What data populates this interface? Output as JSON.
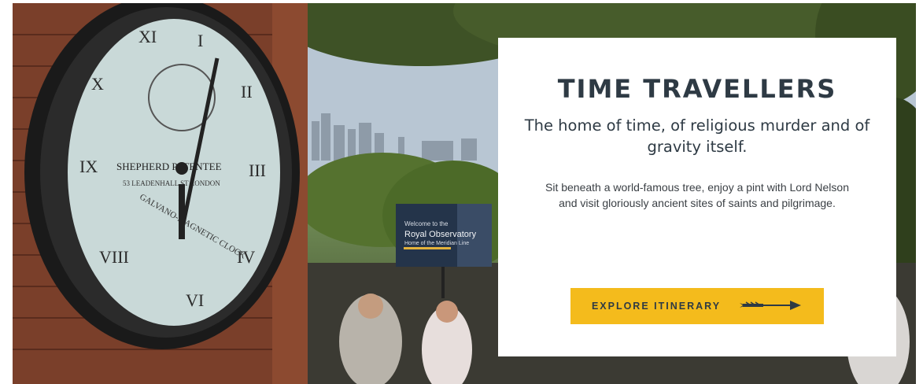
{
  "hero": {
    "photo_subject": "Shepherd Gate Clock at the Royal Observatory, Greenwich",
    "clock_face": {
      "maker_line": "SHEPHERD PATENTEE",
      "address_line": "53 LEADENHALL ST LONDON",
      "arc_line": "GALVANO-MAGNETIC CLOCK"
    },
    "sign": {
      "line1": "Welcome to the",
      "line2": "Royal Observatory",
      "line3": "Home of the Meridian Line"
    }
  },
  "card": {
    "title": "TIME TRAVELLERS",
    "subtitle": "The home of time, of religious murder and of gravity itself.",
    "body": "Sit beneath a world-famous tree, enjoy a pint with Lord Nelson and visit gloriously ancient sites of saints and pilgrimage.",
    "cta_label": "EXPLORE ITINERARY",
    "cta_icon": "arrow-right-icon"
  },
  "colors": {
    "title": "#2e3a44",
    "cta_background": "#f4bb1c",
    "card_background": "#ffffff"
  }
}
